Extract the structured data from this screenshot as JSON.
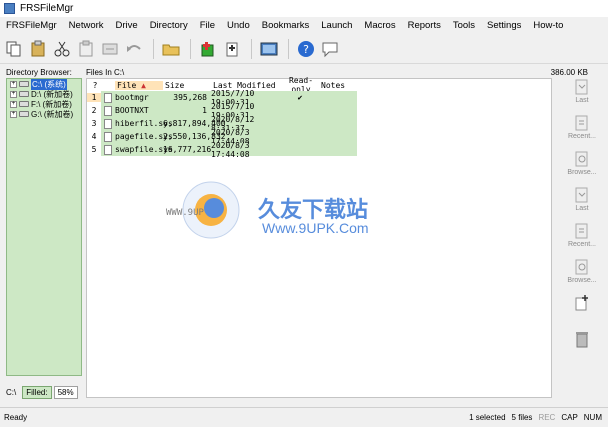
{
  "window": {
    "title": "FRSFileMgr"
  },
  "menu": [
    "FRSFileMgr",
    "Network",
    "Drive",
    "Directory",
    "File",
    "Undo",
    "Bookmarks",
    "Launch",
    "Macros",
    "Reports",
    "Tools",
    "Settings",
    "How-to"
  ],
  "toolbar": {
    "buttons": [
      {
        "icon": "copy-icon"
      },
      {
        "icon": "paste-icon"
      },
      {
        "icon": "cut-icon"
      },
      {
        "icon": "clipboard-icon"
      },
      {
        "icon": "move-icon"
      },
      {
        "icon": "undo-icon"
      },
      {
        "icon": "folder-open-icon"
      },
      {
        "icon": "new-folder-icon"
      },
      {
        "icon": "new-file-icon"
      },
      {
        "icon": "screenshot-icon"
      },
      {
        "icon": "help-icon"
      },
      {
        "icon": "chat-icon"
      }
    ]
  },
  "labels": {
    "directory_browser": "Directory Browser:",
    "files_in": "Files In C:\\",
    "free_space": "386.00 KB"
  },
  "tree": [
    {
      "label": "C:\\ (系统)",
      "selected": true
    },
    {
      "label": "D:\\ (新加卷)",
      "selected": false
    },
    {
      "label": "F:\\ (新加卷)",
      "selected": false
    },
    {
      "label": "G:\\ (新加卷)",
      "selected": false
    }
  ],
  "filelist": {
    "columns": [
      "?",
      "File",
      "Size",
      "Last Modified",
      "Read-only",
      "Notes"
    ],
    "sort_indicator": "▲",
    "rows": [
      {
        "num": "1",
        "name": "bootmgr",
        "size": "395,268",
        "modified": "2015/7/10 19:00:31",
        "readonly": "✔",
        "notes": ""
      },
      {
        "num": "2",
        "name": "BOOTNXT",
        "size": "1",
        "modified": "2015/7/10 19:00:31",
        "readonly": "",
        "notes": ""
      },
      {
        "num": "3",
        "name": "hiberfil.sys",
        "size": "6,817,894,400",
        "modified": "2020/8/12 8:31:37",
        "readonly": "",
        "notes": ""
      },
      {
        "num": "4",
        "name": "pagefile.sys",
        "size": "2,550,136,832",
        "modified": "2020/8/3 17:44:08",
        "readonly": "",
        "notes": ""
      },
      {
        "num": "5",
        "name": "swapfile.sys",
        "size": "16,777,216",
        "modified": "2020/8/3 17:44:08",
        "readonly": "",
        "notes": ""
      }
    ]
  },
  "rightbar": [
    {
      "icon": "last-icon",
      "label": "Last"
    },
    {
      "icon": "recent-icon",
      "label": "Recent..."
    },
    {
      "icon": "browse-icon",
      "label": "Browse..."
    },
    {
      "icon": "last-icon",
      "label": "Last"
    },
    {
      "icon": "recent-icon",
      "label": "Recent..."
    },
    {
      "icon": "browse-icon",
      "label": "Browse..."
    },
    {
      "icon": "add-file-icon",
      "label": ""
    },
    {
      "icon": "trash-icon",
      "label": ""
    }
  ],
  "drive_fill": {
    "drive": "C:\\",
    "filled_label": "Filled:",
    "percent": "58%"
  },
  "watermark": {
    "text": "久友下载站",
    "url": "Www.9UPK.Com",
    "left": "WWW.9UP"
  },
  "status": {
    "ready": "Ready",
    "selected": "1 selected",
    "files": "5 files",
    "rec": "REC",
    "cap": "CAP",
    "num": "NUM"
  },
  "colors": {
    "tree_bg": "#cde8c5",
    "row_bg": "#cde8c5",
    "sort_header_bg": "#ffe3b8",
    "selection": "#2a6ad0"
  }
}
